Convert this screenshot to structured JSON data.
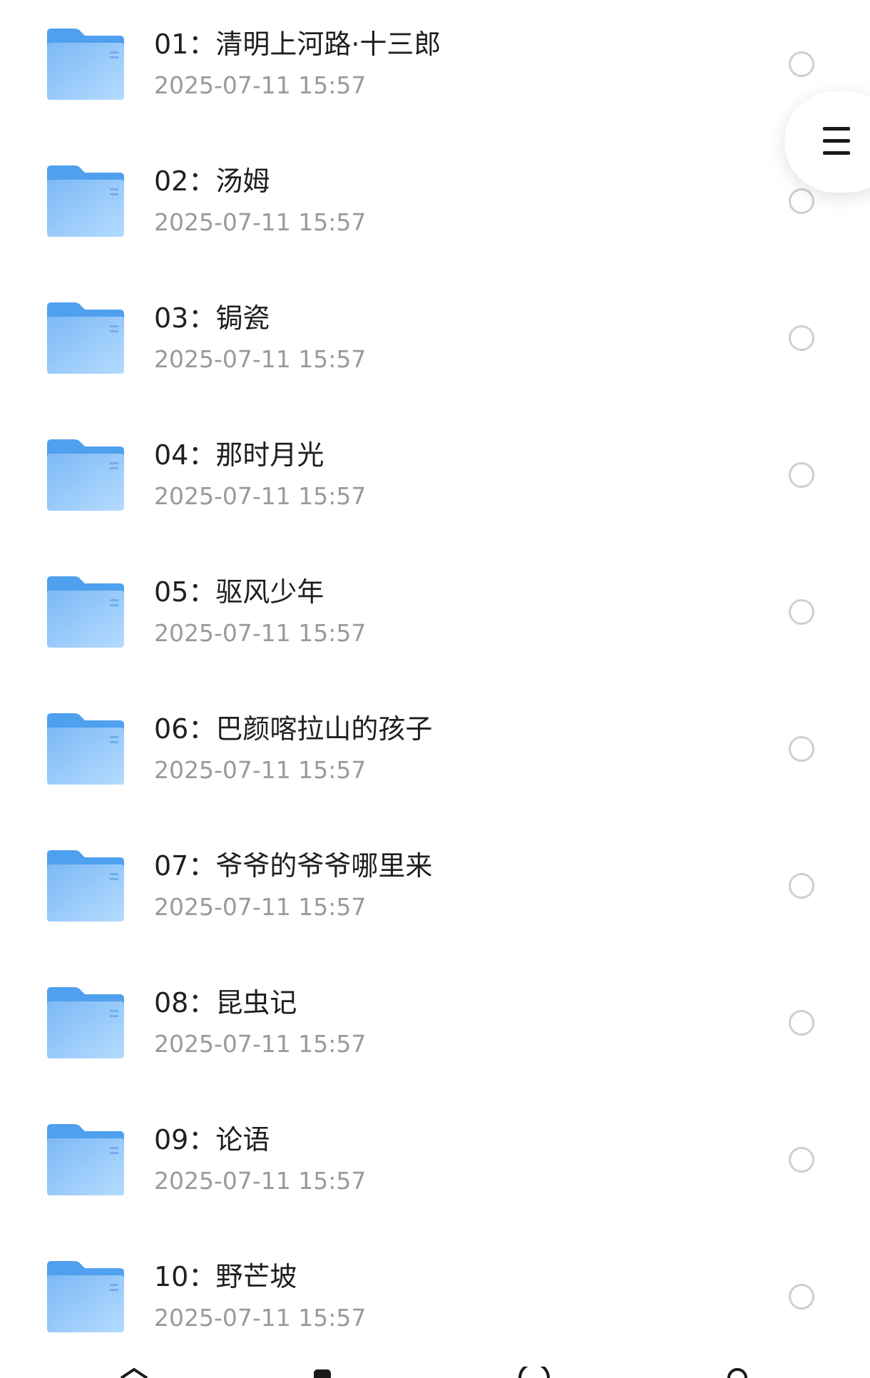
{
  "files": [
    {
      "name": "01：清明上河路·十三郎",
      "modified": "2025-07-11 15:57"
    },
    {
      "name": "02：汤姆",
      "modified": "2025-07-11 15:57"
    },
    {
      "name": "03：锔瓷",
      "modified": "2025-07-11 15:57"
    },
    {
      "name": "04：那时月光",
      "modified": "2025-07-11 15:57"
    },
    {
      "name": "05：驱风少年",
      "modified": "2025-07-11 15:57"
    },
    {
      "name": "06：巴颜喀拉山的孩子",
      "modified": "2025-07-11 15:57"
    },
    {
      "name": "07：爷爷的爷爷哪里来",
      "modified": "2025-07-11 15:57"
    },
    {
      "name": "08：昆虫记",
      "modified": "2025-07-11 15:57"
    },
    {
      "name": "09：论语",
      "modified": "2025-07-11 15:57"
    },
    {
      "name": "10：野芒坡",
      "modified": "2025-07-11 15:57"
    }
  ],
  "icons": {
    "row_icon": "folder-icon",
    "select_icon": "selection-circle-icon",
    "menu_icon": "hamburger-menu-icon"
  },
  "colors": {
    "folder_back": "#4FA0EE",
    "folder_front": "#8FC6FA",
    "name_text": "#1f1f1f",
    "time_text": "#9a9a9a",
    "circle": "#cfcfcf"
  }
}
